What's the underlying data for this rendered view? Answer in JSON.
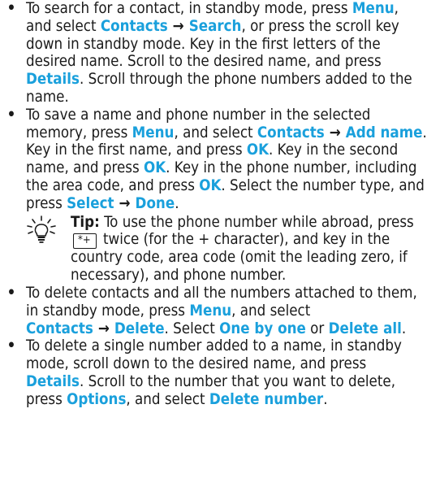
{
  "items": [
    {
      "segments": [
        {
          "t": "To search for a contact, in standby mode, press "
        },
        {
          "k": "Menu"
        },
        {
          "t": ", and select "
        },
        {
          "k": "Contacts"
        },
        {
          "a": "→"
        },
        {
          "k": "Search"
        },
        {
          "t": ", or press the scroll key down in standby mode. Key in the first letters of the desired name. Scroll to the desired name, and press "
        },
        {
          "k": "Details"
        },
        {
          "t": ". Scroll through the phone numbers added to the name."
        }
      ]
    },
    {
      "segments": [
        {
          "t": "To save a name and phone number in the selected memory, press "
        },
        {
          "k": "Menu"
        },
        {
          "t": ", and select "
        },
        {
          "k": "Contacts"
        },
        {
          "a": "→"
        },
        {
          "k": "Add name"
        },
        {
          "t": ". Key in the first name, and press "
        },
        {
          "k": "OK"
        },
        {
          "t": ". Key in the second name, and press "
        },
        {
          "k": "OK"
        },
        {
          "t": ". Key in the phone number, including the area code, and press "
        },
        {
          "k": "OK"
        },
        {
          "t": ". Select the number type, and press "
        },
        {
          "k": "Select"
        },
        {
          "a": "→"
        },
        {
          "k": "Done"
        },
        {
          "t": "."
        }
      ]
    }
  ],
  "tip": {
    "label": "Tip:",
    "before_key": " To use the phone number while abroad, press ",
    "key_label": "*+",
    "after_key": " twice (for the + character), and key in the country code, area code (omit the leading zero, if necessary), and phone number."
  },
  "items_after": [
    {
      "segments": [
        {
          "t": "To delete contacts and all the numbers attached to them, in standby mode, press "
        },
        {
          "k": "Menu"
        },
        {
          "t": ", and select "
        },
        {
          "k": "Contacts"
        },
        {
          "a": "→"
        },
        {
          "k": "Delete"
        },
        {
          "t": ". Select "
        },
        {
          "k": "One by one"
        },
        {
          "t": " or "
        },
        {
          "k": "Delete all"
        },
        {
          "t": "."
        }
      ]
    },
    {
      "segments": [
        {
          "t": "To delete a single number added to a name, in standby mode, scroll down to the desired name, and press "
        },
        {
          "k": "Details"
        },
        {
          "t": ". Scroll to the number that you want to delete, press "
        },
        {
          "k": "Options"
        },
        {
          "t": ", and select "
        },
        {
          "k": "Delete number"
        },
        {
          "t": "."
        }
      ]
    }
  ],
  "bullet_glyph": "•",
  "colors": {
    "keyword": "#1aa0dc",
    "text": "#1a1a1a"
  },
  "icons": {
    "tip": "lightbulb-icon",
    "key": "star-plus-key-icon"
  }
}
